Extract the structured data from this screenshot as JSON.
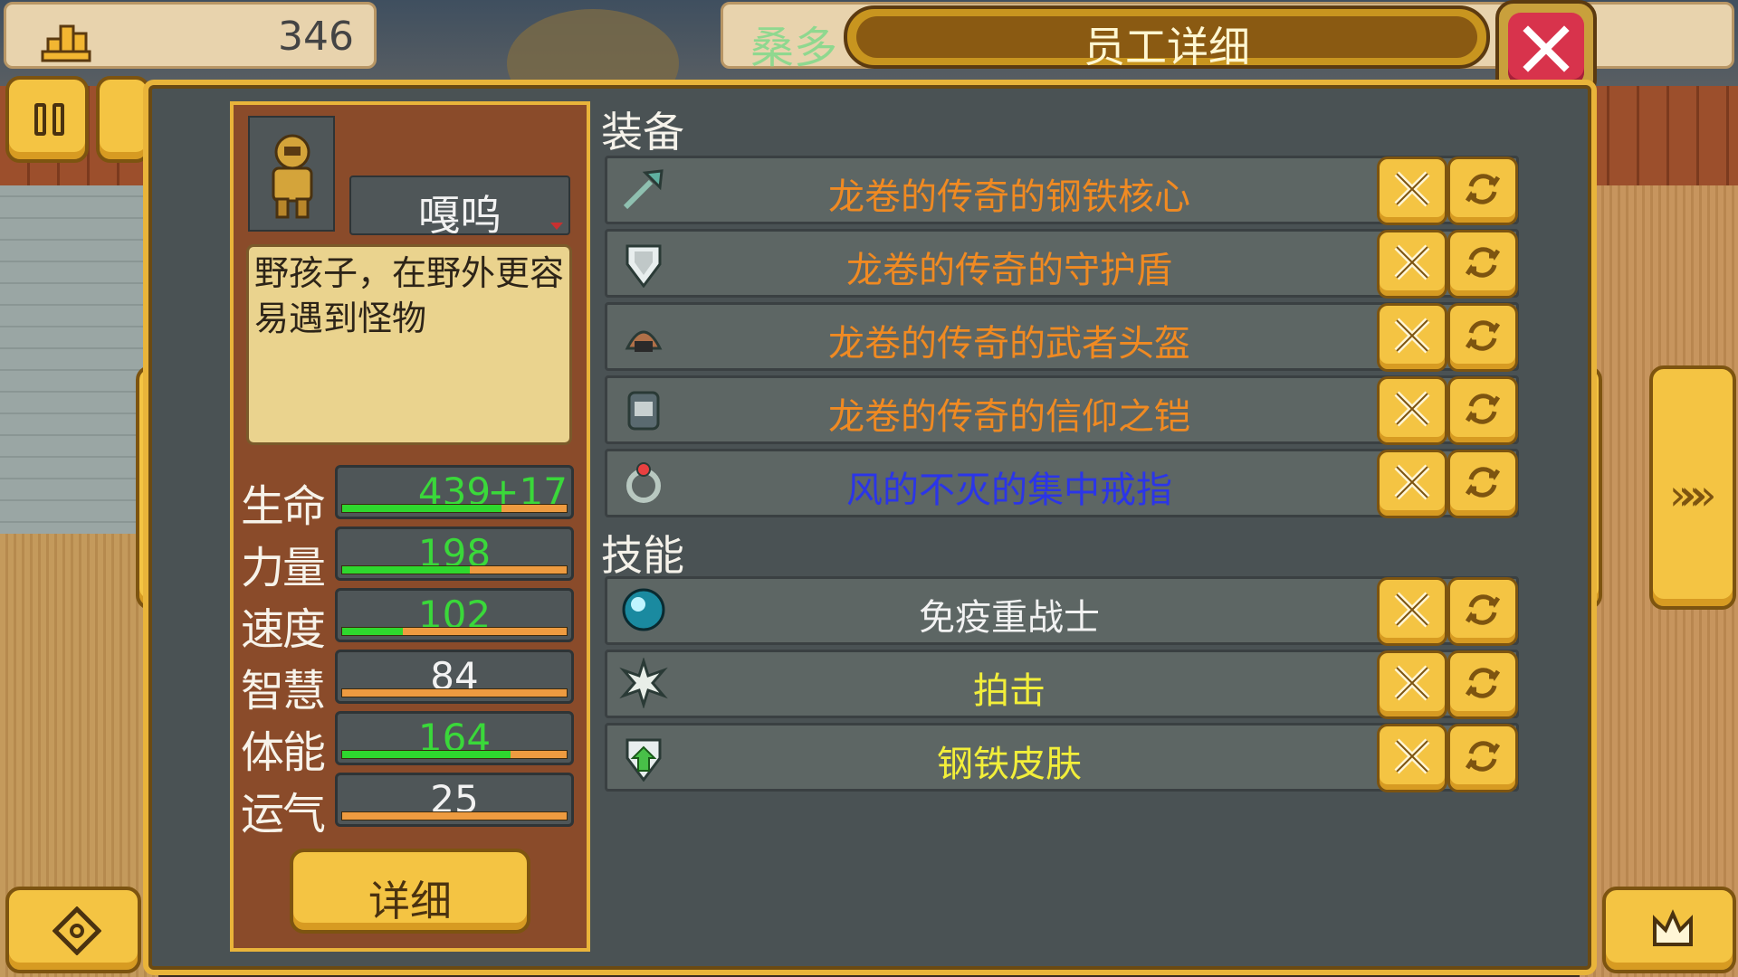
{
  "top_bar": {
    "coins": "346",
    "hero_name_ghost": "桑多",
    "title": "员工详细"
  },
  "character": {
    "name": "嘎呜",
    "trait": "野孩子，在野外更容易遇到怪物",
    "stats": [
      {
        "label": "生命",
        "value": "439",
        "bonus": "+17",
        "value_color": "#3ad83a",
        "fill": 0.71
      },
      {
        "label": "力量",
        "value": "198",
        "bonus": "",
        "value_color": "#3ad83a",
        "fill": 0.57
      },
      {
        "label": "速度",
        "value": "102",
        "bonus": "",
        "value_color": "#3ad83a",
        "fill": 0.27
      },
      {
        "label": "智慧",
        "value": "84",
        "bonus": "",
        "value_color": "#f2f2f2",
        "fill": 0.0
      },
      {
        "label": "体能",
        "value": "164",
        "bonus": "",
        "value_color": "#3ad83a",
        "fill": 0.75
      },
      {
        "label": "运气",
        "value": "25",
        "bonus": "",
        "value_color": "#f2f2f2",
        "fill": 0.0
      }
    ],
    "detail_label": "详细"
  },
  "equipment": {
    "title": "装备",
    "items": [
      {
        "name": "龙卷的传奇的钢铁核心",
        "icon": "axe-icon",
        "color": "#f08a22"
      },
      {
        "name": "龙卷的传奇的守护盾",
        "icon": "shield-icon",
        "color": "#f08a22"
      },
      {
        "name": "龙卷的传奇的武者头盔",
        "icon": "helmet-icon",
        "color": "#f08a22"
      },
      {
        "name": "龙卷的传奇的信仰之铠",
        "icon": "armor-icon",
        "color": "#f08a22"
      },
      {
        "name": "风的不灭的集中戒指",
        "icon": "ring-icon",
        "color": "#2b35e8"
      }
    ]
  },
  "skills": {
    "title": "技能",
    "items": [
      {
        "name": "免疫重战士",
        "icon": "orb-icon",
        "color": "#f2f2f2"
      },
      {
        "name": "拍击",
        "icon": "impact-icon",
        "color": "#f2ee3a"
      },
      {
        "name": "钢铁皮肤",
        "icon": "skin-shield-icon",
        "color": "#f2ee3a"
      }
    ]
  }
}
